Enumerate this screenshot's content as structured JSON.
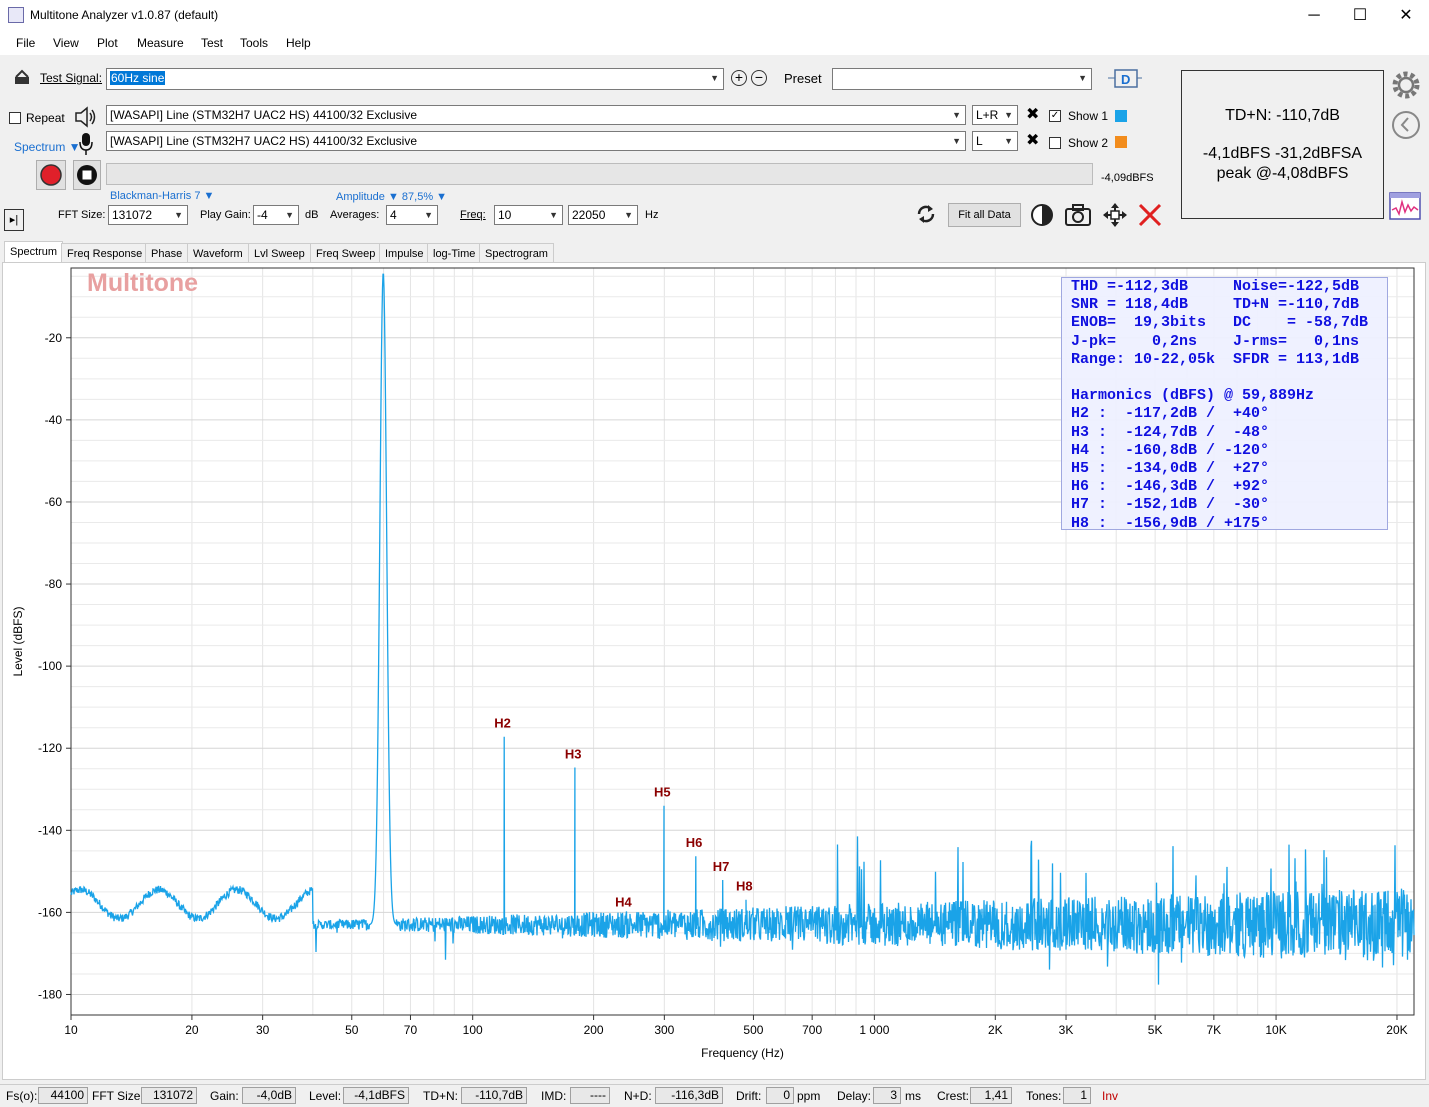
{
  "window": {
    "title": "Multitone Analyzer v1.0.87 (default)",
    "min": "─",
    "max": "☐",
    "close": "✕"
  },
  "menu": [
    "File",
    "View",
    "Plot",
    "Measure",
    "Test",
    "Tools",
    "Help"
  ],
  "toolbar": {
    "test_signal_label": "Test Signal:",
    "test_signal_value": "60Hz sine",
    "preset_label": "Preset",
    "preset_value": "",
    "repeat_label": "Repeat",
    "output_device": "[WASAPI] Line (STM32H7 UAC2 HS) 44100/32 Exclusive",
    "output_channel": "L+R",
    "input_device": "[WASAPI] Line (STM32H7 UAC2 HS) 44100/32 Exclusive",
    "input_channel": "L",
    "show1_label": "Show 1",
    "show2_label": "Show 2",
    "show1_color": "#1aa3e8",
    "show2_color": "#f28c1c",
    "mode_label": "Spectrum ▼",
    "level_readout": "-4,09dBFS",
    "window_label": "Blackman-Harris 7 ▼",
    "amplitude_label": "Amplitude ▼ 87,5% ▼",
    "fft_size_label": "FFT Size:",
    "fft_size_value": "131072",
    "play_gain_label": "Play Gain:",
    "play_gain_value": "-4",
    "play_gain_unit": "dB",
    "averages_label": "Averages:",
    "averages_value": "4",
    "freq_label": "Freq:",
    "freq_from": "10",
    "freq_to": "22050",
    "freq_unit": "Hz",
    "fit_button": "Fit all Data"
  },
  "summary": {
    "line1": "TD+N: -110,7dB",
    "line2": "-4,1dBFS  -31,2dBFSA",
    "line3": "peak @-4,08dBFS"
  },
  "tabs": [
    "Spectrum",
    "Freq Response",
    "Phase",
    "Waveform",
    "Lvl Sweep",
    "Freq Sweep",
    "Impulse",
    "log-Time",
    "Spectrogram"
  ],
  "plot": {
    "watermark": "Multitone",
    "stats_lines": [
      "THD =-112,3dB     Noise=-122,5dB",
      "SNR = 118,4dB     TD+N =-110,7dB",
      "ENOB=  19,3bits   DC    = -58,7dB",
      "J-pk=    0,2ns    J-rms=   0,1ns",
      "Range: 10-22,05k  SFDR = 113,1dB",
      "",
      "Harmonics (dBFS) @ 59,889Hz",
      "H2 :  -117,2dB /  +40°",
      "H3 :  -124,7dB /  -48°",
      "H4 :  -160,8dB / -120°",
      "H5 :  -134,0dB /  +27°",
      "H6 :  -146,3dB /  +92°",
      "H7 :  -152,1dB /  -30°",
      "H8 :  -156,9dB / +175°"
    ]
  },
  "chart_data": {
    "type": "line",
    "xlabel": "Frequency (Hz)",
    "ylabel": "Level (dBFS)",
    "x_scale": "log",
    "xlim": [
      10,
      22050
    ],
    "ylim": [
      -185,
      -3
    ],
    "x_ticks": [
      10,
      20,
      30,
      50,
      70,
      100,
      200,
      300,
      500,
      700,
      1000,
      2000,
      3000,
      5000,
      7000,
      10000,
      20000
    ],
    "x_tick_labels": [
      "10",
      "20",
      "30",
      "50",
      "70",
      "100",
      "200",
      "300",
      "500",
      "700",
      "1 000",
      "2K",
      "3K",
      "5K",
      "7K",
      "10K",
      "20K"
    ],
    "y_ticks": [
      -20,
      -40,
      -60,
      -80,
      -100,
      -120,
      -140,
      -160,
      -180
    ],
    "y_tick_labels": [
      "-20",
      "-40",
      "-60",
      "-80",
      "-100",
      "-120",
      "-140",
      "-160",
      "-180"
    ],
    "grid": true,
    "series_color": "#1aa3e8",
    "fundamental": {
      "freq": 59.889,
      "level": -4.1
    },
    "harmonics": [
      {
        "label": "H2",
        "freq": 119.8,
        "level": -117.2
      },
      {
        "label": "H3",
        "freq": 179.7,
        "level": -124.7
      },
      {
        "label": "H4",
        "freq": 239.6,
        "level": -160.8
      },
      {
        "label": "H5",
        "freq": 299.4,
        "level": -134.0
      },
      {
        "label": "H6",
        "freq": 359.3,
        "level": -146.3
      },
      {
        "label": "H7",
        "freq": 419.2,
        "level": -152.1
      },
      {
        "label": "H8",
        "freq": 479.1,
        "level": -156.9
      }
    ],
    "noise_floor": -163
  },
  "status": {
    "fs_label": "Fs(o):",
    "fs": "44100",
    "fft_label": "FFT Size:",
    "fft": "131072",
    "gain_label": "Gain:",
    "gain": "-4,0dB",
    "level_label": "Level:",
    "level": "-4,1dBFS",
    "tdn_label": "TD+N:",
    "tdn": "-110,7dB",
    "imd_label": "IMD:",
    "imd": "----",
    "nd_label": "N+D:",
    "nd": "-116,3dB",
    "drift_label": "Drift:",
    "drift": "0",
    "drift_unit": "ppm",
    "delay_label": "Delay:",
    "delay": "3",
    "delay_unit": "ms",
    "crest_label": "Crest:",
    "crest": "1,41",
    "tones_label": "Tones:",
    "tones": "1",
    "inv_label": "Inv"
  }
}
